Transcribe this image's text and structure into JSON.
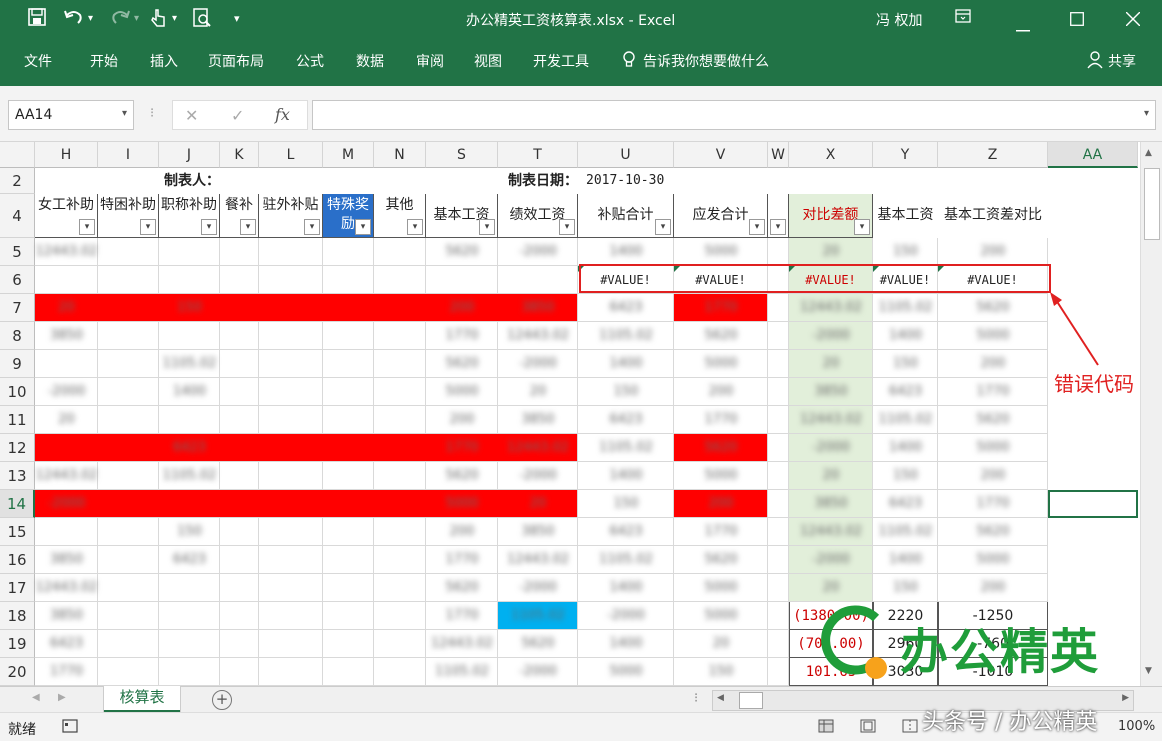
{
  "titlebar": {
    "doc_title": "办公精英工资核算表.xlsx  -  Excel",
    "user": "冯 权加",
    "icons": [
      "save-icon",
      "undo-icon",
      "redo-icon",
      "touch-mode-icon",
      "print-preview-icon",
      "customize-qat-icon"
    ],
    "window_controls": [
      "ribbon-display-icon",
      "minimize-icon",
      "maximize-icon",
      "close-icon"
    ]
  },
  "ribbon": {
    "tabs": [
      "文件",
      "开始",
      "插入",
      "页面布局",
      "公式",
      "数据",
      "审阅",
      "视图",
      "开发工具"
    ],
    "tell_me": "告诉我你想要做什么",
    "share": "共享"
  },
  "formula_bar": {
    "name_box": "AA14",
    "cancel": "✕",
    "enter": "✓",
    "fx": "fx",
    "formula": ""
  },
  "columns": [
    "H",
    "I",
    "J",
    "K",
    "L",
    "M",
    "N",
    "S",
    "T",
    "U",
    "V",
    "W",
    "X",
    "Y",
    "Z",
    "AA"
  ],
  "rows": [
    "2",
    "4",
    "5",
    "6",
    "7",
    "8",
    "9",
    "10",
    "11",
    "12",
    "13",
    "14",
    "15",
    "16",
    "17",
    "18",
    "19",
    "20"
  ],
  "sheet": {
    "maker_label": "制表人：",
    "date_label": "制表日期：",
    "date_value": "2017-10-30",
    "headers": {
      "H": "女工补助",
      "I": "特困补助",
      "J": "职称补助",
      "K": "餐补",
      "L": "驻外补贴",
      "M": "特殊奖励",
      "N": "其他",
      "S": "基本工资",
      "T": "绩效工资",
      "U": "补贴合计",
      "V": "应发合计",
      "X": "对比差额",
      "Y": "基本工资",
      "Z": "基本工资差对比"
    },
    "error_value": "#VALUE!",
    "row18": {
      "X": "(1380.00)",
      "Y": "2220",
      "Z": "-1250"
    },
    "row19": {
      "X": "(700.00)",
      "Y": "2960",
      "Z": "-760"
    },
    "row20": {
      "X": "101.65",
      "Y": "3030",
      "Z": "-1010"
    },
    "blurred_samples": [
      "20",
      "150",
      "200",
      "3850",
      "6423",
      "1770",
      "12443.02",
      "1105.02",
      "5620",
      "-2000",
      "1400",
      "5000"
    ]
  },
  "annotation": {
    "label": "错误代码",
    "color": "#e02020"
  },
  "watermark": {
    "brand": "办公精英",
    "source": "头条号 / 办公精英"
  },
  "sheet_tabs": {
    "active": "核算表",
    "add": "+"
  },
  "status_bar": {
    "ready": "就绪",
    "zoom": "100%"
  },
  "colors": {
    "excel_green": "#217346",
    "highlight_red": "#ff0000",
    "diff_green": "#e2efda",
    "cyan": "#00b0f0"
  }
}
